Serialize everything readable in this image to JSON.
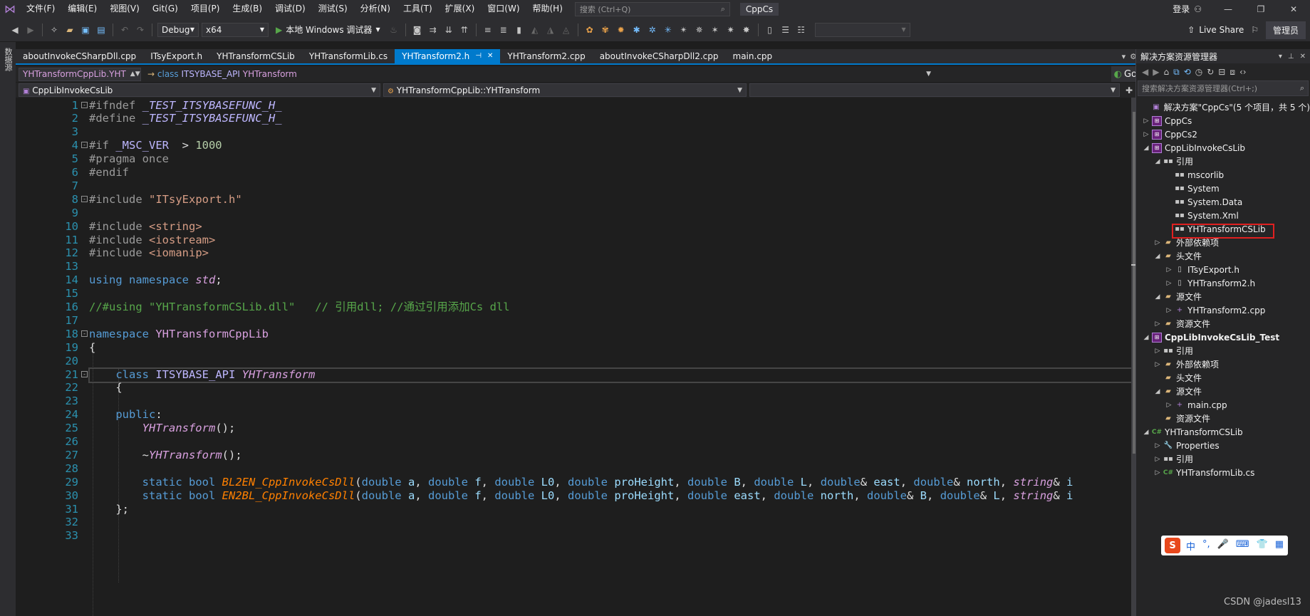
{
  "menubar": {
    "items": [
      "文件(F)",
      "编辑(E)",
      "视图(V)",
      "Git(G)",
      "项目(P)",
      "生成(B)",
      "调试(D)",
      "测试(S)",
      "分析(N)",
      "工具(T)",
      "扩展(X)",
      "窗口(W)",
      "帮助(H)"
    ],
    "search_placeholder": "搜索 (Ctrl+Q)",
    "solution_name": "CppCs",
    "login_label": "登录"
  },
  "toolbar": {
    "config": "Debug",
    "platform": "x64",
    "run_label": "本地 Windows 调试器",
    "live_share": "Live Share",
    "admin": "管理员"
  },
  "left_strip_label": "数据源",
  "tabs": [
    {
      "label": "aboutInvokeCSharpDll.cpp",
      "active": false
    },
    {
      "label": "ITsyExport.h",
      "active": false
    },
    {
      "label": "YHTransformCSLib",
      "active": false
    },
    {
      "label": "YHTransformLib.cs",
      "active": false
    },
    {
      "label": "YHTransform2.h",
      "active": true
    },
    {
      "label": "YHTransform2.cpp",
      "active": false
    },
    {
      "label": "aboutInvokeCSharpDll2.cpp",
      "active": false
    },
    {
      "label": "main.cpp",
      "active": false
    }
  ],
  "nav": {
    "scope": "YHTransformCppLib.YHT",
    "class_kw": "class",
    "class_macro": "ITSYBASE_API",
    "class_name": "YHTransform",
    "go_label": "Go",
    "project": "CppLibInvokeCsLib",
    "member": "YHTransformCppLib::YHTransform"
  },
  "code_lines": [
    {
      "n": "1",
      "fold": "-",
      "tokens": [
        [
          "c-pre",
          "#ifndef "
        ],
        [
          "c-macro-i",
          "_TEST_ITSYBASEFUNC_H_"
        ]
      ]
    },
    {
      "n": "2",
      "fold": "",
      "tokens": [
        [
          "c-pre",
          "#define "
        ],
        [
          "c-macro-i",
          "_TEST_ITSYBASEFUNC_H_"
        ]
      ]
    },
    {
      "n": "3",
      "fold": "",
      "tokens": []
    },
    {
      "n": "4",
      "fold": "-",
      "tokens": [
        [
          "c-pre",
          "#if "
        ],
        [
          "c-mac2",
          "_MSC_VER"
        ],
        [
          "",
          "  > "
        ],
        [
          "c-num",
          "1000"
        ]
      ]
    },
    {
      "n": "5",
      "fold": "",
      "tokens": [
        [
          "c-pre",
          "#pragma once"
        ]
      ]
    },
    {
      "n": "6",
      "fold": "",
      "tokens": [
        [
          "c-pre",
          "#endif"
        ]
      ]
    },
    {
      "n": "7",
      "fold": "",
      "tokens": []
    },
    {
      "n": "8",
      "fold": "-",
      "tokens": [
        [
          "c-pre",
          "#include "
        ],
        [
          "c-str",
          "\"ITsyExport.h\""
        ]
      ]
    },
    {
      "n": "9",
      "fold": "",
      "tokens": []
    },
    {
      "n": "10",
      "fold": "",
      "tokens": [
        [
          "c-pre",
          "#include "
        ],
        [
          "c-str",
          "<string>"
        ]
      ]
    },
    {
      "n": "11",
      "fold": "",
      "tokens": [
        [
          "c-pre",
          "#include "
        ],
        [
          "c-str",
          "<iostream>"
        ]
      ]
    },
    {
      "n": "12",
      "fold": "",
      "tokens": [
        [
          "c-pre",
          "#include "
        ],
        [
          "c-str",
          "<iomanip>"
        ]
      ]
    },
    {
      "n": "13",
      "fold": "",
      "tokens": []
    },
    {
      "n": "14",
      "fold": "",
      "tokens": [
        [
          "c-kw",
          "using "
        ],
        [
          "c-kw",
          "namespace "
        ],
        [
          "c-nsi",
          "std"
        ],
        [
          "",
          ";"
        ]
      ]
    },
    {
      "n": "15",
      "fold": "",
      "tokens": []
    },
    {
      "n": "16",
      "fold": "",
      "tokens": [
        [
          "c-cmt",
          "//#using \"YHTransformCSLib.dll\"   // 引用dll; //通过引用添加Cs dll"
        ]
      ]
    },
    {
      "n": "17",
      "fold": "",
      "tokens": []
    },
    {
      "n": "18",
      "fold": "-",
      "tokens": [
        [
          "c-kw",
          "namespace "
        ],
        [
          "c-ns",
          "YHTransformCppLib"
        ]
      ]
    },
    {
      "n": "19",
      "fold": "",
      "tokens": [
        [
          "",
          "{"
        ]
      ]
    },
    {
      "n": "20",
      "fold": "",
      "tokens": []
    },
    {
      "n": "21",
      "fold": "-",
      "tokens": [
        [
          "",
          "    "
        ],
        [
          "c-kw",
          "class "
        ],
        [
          "c-mac2",
          "ITSYBASE_API "
        ],
        [
          "c-cls",
          "YHTransform"
        ]
      ]
    },
    {
      "n": "22",
      "fold": "",
      "tokens": [
        [
          "",
          "    {"
        ]
      ]
    },
    {
      "n": "23",
      "fold": "",
      "tokens": []
    },
    {
      "n": "24",
      "fold": "",
      "tokens": [
        [
          "",
          "    "
        ],
        [
          "c-kw",
          "public"
        ],
        [
          "",
          ":"
        ]
      ]
    },
    {
      "n": "25",
      "fold": "",
      "tokens": [
        [
          "",
          "        "
        ],
        [
          "c-cls",
          "YHTransform"
        ],
        [
          "",
          "();"
        ]
      ]
    },
    {
      "n": "26",
      "fold": "",
      "tokens": []
    },
    {
      "n": "27",
      "fold": "",
      "tokens": [
        [
          "",
          "        ~"
        ],
        [
          "c-cls",
          "YHTransform"
        ],
        [
          "",
          "();"
        ]
      ]
    },
    {
      "n": "28",
      "fold": "",
      "tokens": []
    },
    {
      "n": "29",
      "fold": "",
      "tokens": [
        [
          "",
          "        "
        ],
        [
          "c-kw",
          "static "
        ],
        [
          "c-kw",
          "bool "
        ],
        [
          "c-fn",
          "BL2EN_CppInvokeCsDll"
        ],
        [
          "",
          "("
        ],
        [
          "c-kw",
          "double "
        ],
        [
          "c-param",
          "a"
        ],
        [
          "",
          ", "
        ],
        [
          "c-kw",
          "double "
        ],
        [
          "c-param",
          "f"
        ],
        [
          "",
          ", "
        ],
        [
          "c-kw",
          "double "
        ],
        [
          "c-param",
          "L0"
        ],
        [
          "",
          ", "
        ],
        [
          "c-kw",
          "double "
        ],
        [
          "c-param",
          "proHeight"
        ],
        [
          "",
          ", "
        ],
        [
          "c-kw",
          "double "
        ],
        [
          "c-param",
          "B"
        ],
        [
          "",
          ", "
        ],
        [
          "c-kw",
          "double "
        ],
        [
          "c-param",
          "L"
        ],
        [
          "",
          ", "
        ],
        [
          "c-kw",
          "double"
        ],
        [
          "",
          "& "
        ],
        [
          "c-param",
          "east"
        ],
        [
          "",
          ", "
        ],
        [
          "c-kw",
          "double"
        ],
        [
          "",
          "& "
        ],
        [
          "c-param",
          "north"
        ],
        [
          "",
          ", "
        ],
        [
          "c-type",
          "string"
        ],
        [
          "",
          "& "
        ],
        [
          "c-param",
          "i"
        ]
      ]
    },
    {
      "n": "30",
      "fold": "",
      "tokens": [
        [
          "",
          "        "
        ],
        [
          "c-kw",
          "static "
        ],
        [
          "c-kw",
          "bool "
        ],
        [
          "c-fn",
          "EN2BL_CppInvokeCsDll"
        ],
        [
          "",
          "("
        ],
        [
          "c-kw",
          "double "
        ],
        [
          "c-param",
          "a"
        ],
        [
          "",
          ", "
        ],
        [
          "c-kw",
          "double "
        ],
        [
          "c-param",
          "f"
        ],
        [
          "",
          ", "
        ],
        [
          "c-kw",
          "double "
        ],
        [
          "c-param",
          "L0"
        ],
        [
          "",
          ", "
        ],
        [
          "c-kw",
          "double "
        ],
        [
          "c-param",
          "proHeight"
        ],
        [
          "",
          ", "
        ],
        [
          "c-kw",
          "double "
        ],
        [
          "c-param",
          "east"
        ],
        [
          "",
          ", "
        ],
        [
          "c-kw",
          "double "
        ],
        [
          "c-param",
          "north"
        ],
        [
          "",
          ", "
        ],
        [
          "c-kw",
          "double"
        ],
        [
          "",
          "& "
        ],
        [
          "c-param",
          "B"
        ],
        [
          "",
          ", "
        ],
        [
          "c-kw",
          "double"
        ],
        [
          "",
          "& "
        ],
        [
          "c-param",
          "L"
        ],
        [
          "",
          ", "
        ],
        [
          "c-type",
          "string"
        ],
        [
          "",
          "& "
        ],
        [
          "c-param",
          "i"
        ]
      ]
    },
    {
      "n": "31",
      "fold": "",
      "tokens": [
        [
          "",
          "    };"
        ]
      ]
    },
    {
      "n": "32",
      "fold": "",
      "tokens": []
    },
    {
      "n": "33",
      "fold": "",
      "tokens": []
    }
  ],
  "solution_explorer": {
    "title": "解决方案资源管理器",
    "search_placeholder": "搜索解决方案资源管理器(Ctrl+;)",
    "tree": [
      {
        "depth": 0,
        "arrow": "",
        "icon": "sol",
        "label": "解决方案\"CppCs\"(5 个项目，共 5 个)"
      },
      {
        "depth": 0,
        "arrow": "▷",
        "icon": "proj",
        "label": "CppCs"
      },
      {
        "depth": 0,
        "arrow": "▷",
        "icon": "proj",
        "label": "CppCs2"
      },
      {
        "depth": 0,
        "arrow": "◢",
        "icon": "proj",
        "label": "CppLibInvokeCsLib"
      },
      {
        "depth": 1,
        "arrow": "◢",
        "icon": "ref",
        "label": "引用"
      },
      {
        "depth": 2,
        "arrow": "",
        "icon": "ref",
        "label": "mscorlib"
      },
      {
        "depth": 2,
        "arrow": "",
        "icon": "ref",
        "label": "System"
      },
      {
        "depth": 2,
        "arrow": "",
        "icon": "ref",
        "label": "System.Data"
      },
      {
        "depth": 2,
        "arrow": "",
        "icon": "ref",
        "label": "System.Xml"
      },
      {
        "depth": 2,
        "arrow": "",
        "icon": "ref",
        "label": "YHTransformCSLib"
      },
      {
        "depth": 1,
        "arrow": "▷",
        "icon": "folder",
        "label": "外部依赖项"
      },
      {
        "depth": 1,
        "arrow": "◢",
        "icon": "folder",
        "label": "头文件"
      },
      {
        "depth": 2,
        "arrow": "▷",
        "icon": "file",
        "label": "ITsyExport.h"
      },
      {
        "depth": 2,
        "arrow": "▷",
        "icon": "file",
        "label": "YHTransform2.h"
      },
      {
        "depth": 1,
        "arrow": "◢",
        "icon": "folder",
        "label": "源文件"
      },
      {
        "depth": 2,
        "arrow": "▷",
        "icon": "cpp",
        "label": "YHTransform2.cpp"
      },
      {
        "depth": 1,
        "arrow": "▷",
        "icon": "folder",
        "label": "资源文件"
      },
      {
        "depth": 0,
        "arrow": "◢",
        "icon": "proj",
        "label": "CppLibInvokeCsLib_Test",
        "bold": true
      },
      {
        "depth": 1,
        "arrow": "▷",
        "icon": "ref",
        "label": "引用"
      },
      {
        "depth": 1,
        "arrow": "▷",
        "icon": "folder",
        "label": "外部依赖项"
      },
      {
        "depth": 1,
        "arrow": "",
        "icon": "folder",
        "label": "头文件"
      },
      {
        "depth": 1,
        "arrow": "◢",
        "icon": "folder",
        "label": "源文件"
      },
      {
        "depth": 2,
        "arrow": "▷",
        "icon": "cpp",
        "label": "main.cpp"
      },
      {
        "depth": 1,
        "arrow": "",
        "icon": "folder",
        "label": "资源文件"
      },
      {
        "depth": 0,
        "arrow": "◢",
        "icon": "cs",
        "label": "YHTransformCSLib"
      },
      {
        "depth": 1,
        "arrow": "▷",
        "icon": "wrench",
        "label": "Properties"
      },
      {
        "depth": 1,
        "arrow": "▷",
        "icon": "ref",
        "label": "引用"
      },
      {
        "depth": 1,
        "arrow": "▷",
        "icon": "cs",
        "label": "YHTransformLib.cs"
      }
    ]
  },
  "ime": {
    "logo": "S",
    "items": [
      "中",
      "°,",
      "🎤",
      "⌨",
      "👕",
      "▦"
    ]
  },
  "watermark": "CSDN @jadesl13"
}
